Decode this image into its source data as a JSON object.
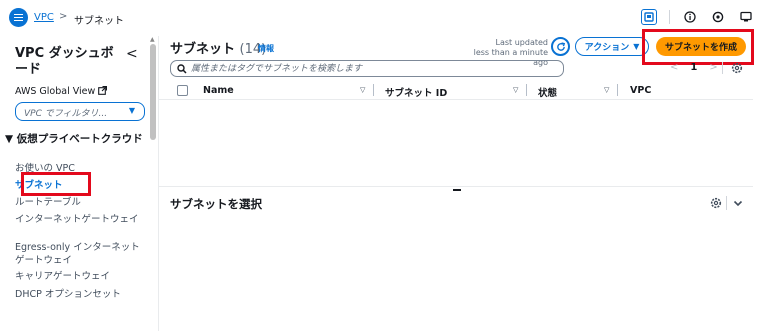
{
  "breadcrumb": {
    "root": "VPC",
    "separator": ">",
    "current": "サブネット"
  },
  "top_icons": [
    "cloudshell-icon",
    "info-circle-icon",
    "settings-icon",
    "notifications-icon"
  ],
  "sidebar": {
    "title": "VPC ダッシュボード",
    "collapse_glyph": "<",
    "global_view": "AWS Global View",
    "filter_placeholder": "VPC でフィルタリ...",
    "section": "▼ 仮想プライベートクラウド",
    "items": [
      {
        "label": "お使いの VPC",
        "active": false
      },
      {
        "label": "サブネット",
        "active": true
      },
      {
        "label": "ルートテーブル",
        "active": false
      },
      {
        "label": "インターネットゲートウェイ",
        "active": false
      },
      {
        "label": "Egress-only インターネットゲートウェイ",
        "active": false
      },
      {
        "label": "キャリアゲートウェイ",
        "active": false
      },
      {
        "label": "DHCP オプションセット",
        "active": false
      }
    ]
  },
  "main": {
    "title": "サブネット",
    "count": "(14)",
    "info": "情報",
    "last_updated_line1": "Last updated",
    "last_updated_line2": "less than a minute ago",
    "actions_label": "アクション",
    "create_label": "サブネットを作成",
    "search_placeholder": "属性またはタグでサブネットを検索します",
    "pagination": {
      "prev": "<",
      "page": "1",
      "next": ">"
    },
    "columns": [
      "Name",
      "サブネット ID",
      "状態",
      "VPC"
    ],
    "selection_title": "サブネットを選択"
  },
  "colors": {
    "accent": "#0972d3",
    "primary_button": "#ff9900",
    "highlight": "#e3091c"
  }
}
